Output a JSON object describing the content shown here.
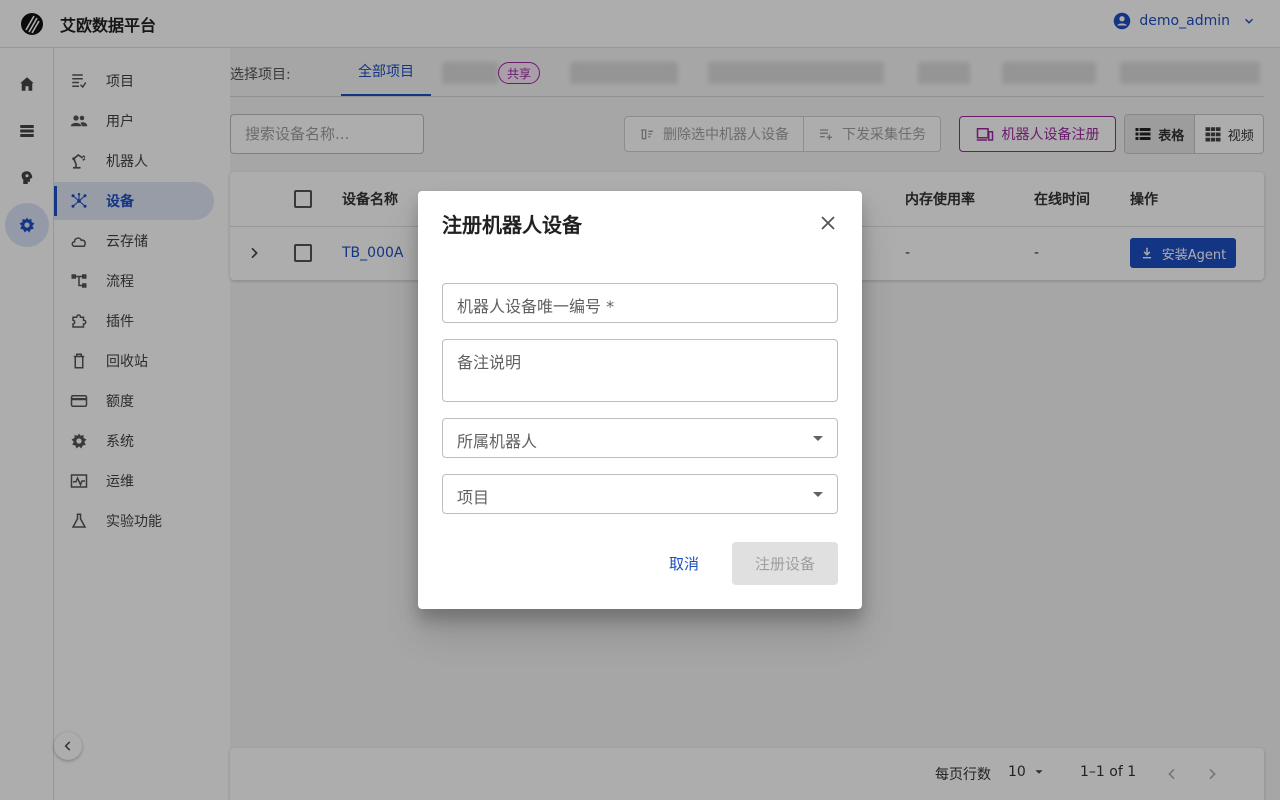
{
  "app": {
    "title": "艾欧数据平台",
    "user": "demo_admin"
  },
  "rail": [
    {
      "icon": "home-icon"
    },
    {
      "icon": "list-icon"
    },
    {
      "icon": "brain-icon"
    },
    {
      "icon": "gear-icon"
    }
  ],
  "sidebar": {
    "items": [
      {
        "label": "项目",
        "icon": "project-list-icon"
      },
      {
        "label": "用户",
        "icon": "users-icon"
      },
      {
        "label": "机器人",
        "icon": "robot-arm-icon"
      },
      {
        "label": "设备",
        "icon": "device-network-icon"
      },
      {
        "label": "云存储",
        "icon": "cloud-icon"
      },
      {
        "label": "流程",
        "icon": "flow-icon"
      },
      {
        "label": "插件",
        "icon": "puzzle-icon"
      },
      {
        "label": "回收站",
        "icon": "trash-icon"
      },
      {
        "label": "额度",
        "icon": "credit-card-icon"
      },
      {
        "label": "系统",
        "icon": "settings-icon"
      },
      {
        "label": "运维",
        "icon": "monitor-icon"
      },
      {
        "label": "实验功能",
        "icon": "flask-icon"
      }
    ]
  },
  "projects": {
    "label": "选择项目:",
    "active_tab": "全部项目",
    "share_badge": "共享"
  },
  "search": {
    "placeholder": "搜索设备名称..."
  },
  "toolbar": {
    "delete_label": "删除选中机器人设备",
    "dispatch_label": "下发采集任务",
    "register_label": "机器人设备注册",
    "view_table": "表格",
    "view_video": "视频"
  },
  "table": {
    "columns": {
      "name": "设备名称",
      "memory": "内存使用率",
      "online": "在线时间",
      "actions": "操作"
    },
    "rows": [
      {
        "name": "TB_000A",
        "memory": "-",
        "online": "-",
        "action": "安装Agent"
      }
    ]
  },
  "pagination": {
    "rows_per_page_label": "每页行数",
    "rows_per_page": "10",
    "range": "1–1 of 1"
  },
  "dialog": {
    "title": "注册机器人设备",
    "fields": {
      "device_id": "机器人设备唯一编号 *",
      "remark": "备注说明",
      "robot": "所属机器人",
      "project": "项目"
    },
    "cancel": "取消",
    "submit": "注册设备"
  },
  "colors": {
    "primary": "#1e4fc2",
    "accent": "#9c2aa0"
  }
}
